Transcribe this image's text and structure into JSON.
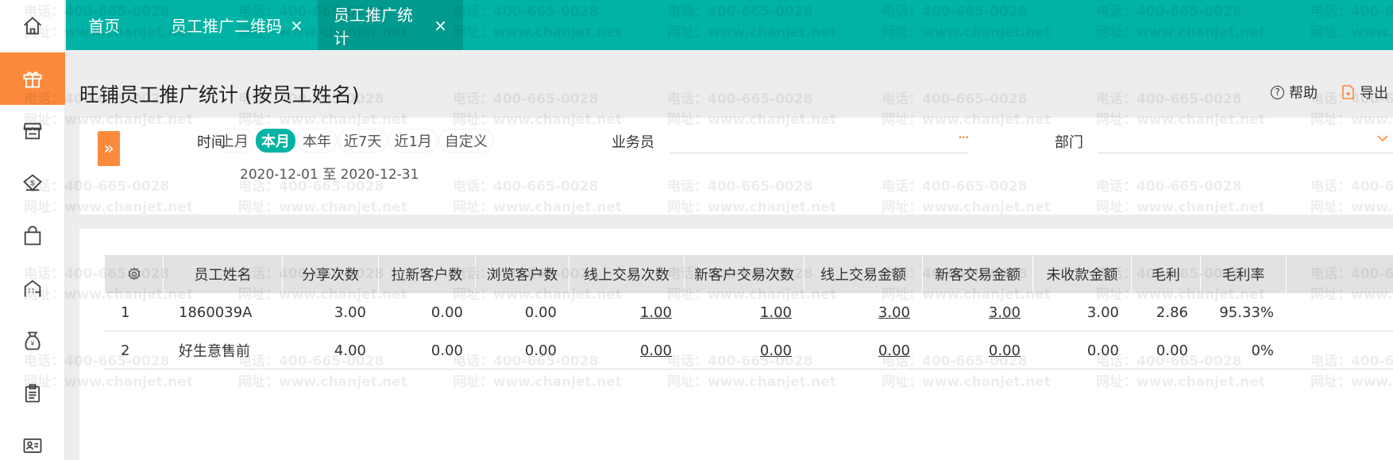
{
  "sidebar": {
    "items": [
      {
        "icon": "home-icon"
      },
      {
        "icon": "gift-icon",
        "active": true
      },
      {
        "icon": "store-icon"
      },
      {
        "icon": "money-bag-icon"
      },
      {
        "icon": "shopping-bag-icon"
      },
      {
        "icon": "building-icon"
      },
      {
        "icon": "yen-pouch-icon"
      },
      {
        "icon": "clipboard-icon"
      },
      {
        "icon": "contact-card-icon"
      }
    ]
  },
  "tabs": [
    {
      "label": "首页",
      "closable": false
    },
    {
      "label": "员工推广二维码",
      "closable": true
    },
    {
      "label": "员工推广统计",
      "closable": true,
      "active": true
    }
  ],
  "tab_close_glyph": "×",
  "page": {
    "title": "旺铺员工推广统计 (按员工姓名)",
    "help_label": "帮助",
    "help_glyph": "?",
    "export_label": "导出"
  },
  "filters": {
    "expand_glyph": "»",
    "time_label": "时间",
    "time_options": [
      "上月",
      "本月",
      "本年",
      "近7天",
      "近1月",
      "自定义"
    ],
    "time_selected": "本月",
    "date_range": "2020-12-01 至 2020-12-31",
    "salesperson_label": "业务员",
    "salesperson_value": "",
    "salesperson_more": "···",
    "department_label": "部门",
    "department_value": ""
  },
  "table": {
    "columns": [
      "员工姓名",
      "分享次数",
      "拉新客户数",
      "浏览客户数",
      "线上交易次数",
      "新客户交易次数",
      "线上交易金额",
      "新客交易金额",
      "未收款金额",
      "毛利",
      "毛利率"
    ],
    "rows": [
      {
        "index": "1",
        "name": "1860039A",
        "shares": "3.00",
        "new_customers": "0.00",
        "browsing_customers": "0.00",
        "online_trades": "1.00",
        "new_customer_trades": "1.00",
        "online_amount": "3.00",
        "new_customer_amount": "3.00",
        "unpaid": "3.00",
        "gross_profit": "2.86",
        "margin": "95.33%"
      },
      {
        "index": "2",
        "name": "好生意售前",
        "shares": "4.00",
        "new_customers": "0.00",
        "browsing_customers": "0.00",
        "online_trades": "0.00",
        "new_customer_trades": "0.00",
        "online_amount": "0.00",
        "new_customer_amount": "0.00",
        "unpaid": "0.00",
        "gross_profit": "0.00",
        "margin": "0%"
      }
    ]
  },
  "watermark": {
    "phone": "电话：400-665-0028",
    "site": "网址：www.chanjet.net"
  },
  "colors": {
    "teal": "#00b3a4",
    "orange": "#fb8a3c"
  }
}
